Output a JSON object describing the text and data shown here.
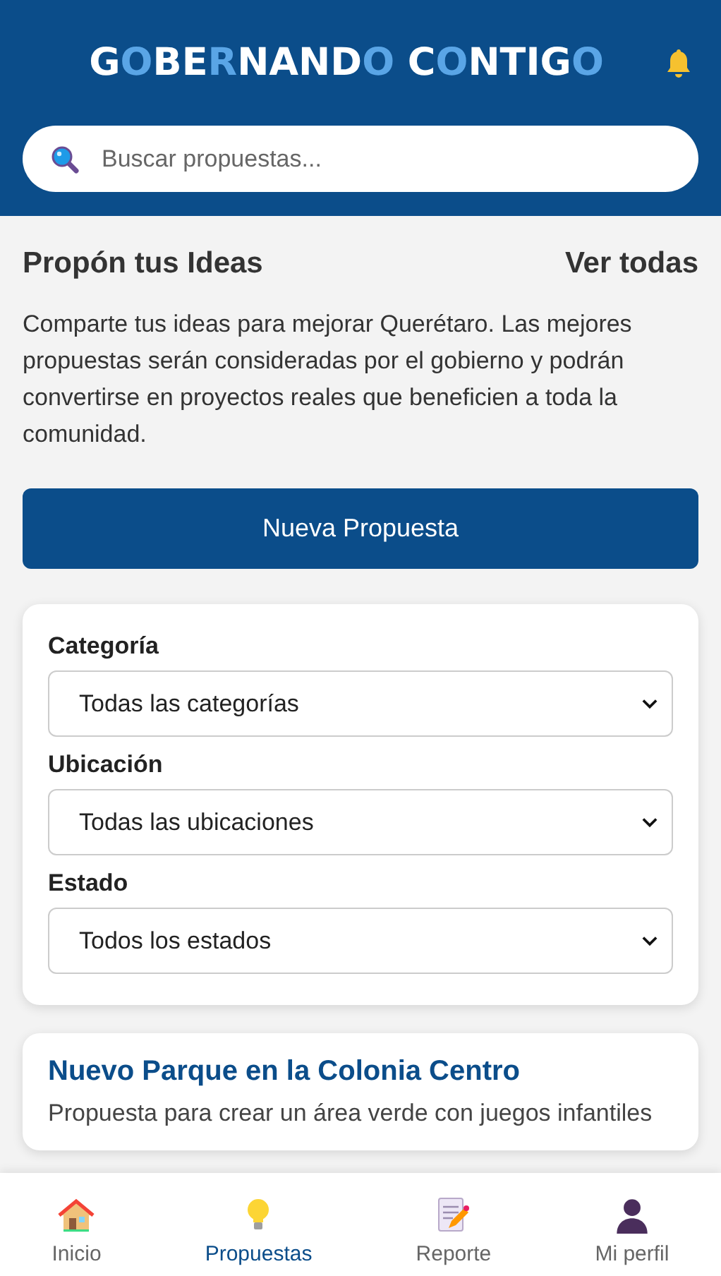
{
  "header": {
    "logo": [
      {
        "text": "G",
        "accent": false
      },
      {
        "text": "O",
        "accent": true
      },
      {
        "text": "BE",
        "accent": false
      },
      {
        "text": "R",
        "accent": true
      },
      {
        "text": "NAND",
        "accent": false
      },
      {
        "text": "O",
        "accent": true
      },
      {
        "text": " C",
        "accent": false
      },
      {
        "text": "O",
        "accent": true
      },
      {
        "text": "NTIG",
        "accent": false
      },
      {
        "text": "O",
        "accent": true
      }
    ]
  },
  "search": {
    "placeholder": "Buscar propuestas..."
  },
  "section": {
    "title": "Propón tus Ideas",
    "link": "Ver todas",
    "description": "Comparte tus ideas para mejorar Querétaro. Las mejores propuestas serán consideradas por el gobierno y podrán convertirse en proyectos reales que beneficien a toda la comunidad."
  },
  "new_button": "Nueva Propuesta",
  "filters": [
    {
      "label": "Categoría",
      "value": "Todas las categorías"
    },
    {
      "label": "Ubicación",
      "value": "Todas las ubicaciones"
    },
    {
      "label": "Estado",
      "value": "Todos los estados"
    }
  ],
  "proposals": [
    {
      "title": "Nuevo Parque en la Colonia Centro",
      "description": "Propuesta para crear un área verde con juegos infantiles"
    }
  ],
  "nav": [
    {
      "label": "Inicio",
      "selected": false
    },
    {
      "label": "Propuestas",
      "selected": true
    },
    {
      "label": "Reporte",
      "selected": false
    },
    {
      "label": "Mi perfil",
      "selected": false
    }
  ]
}
